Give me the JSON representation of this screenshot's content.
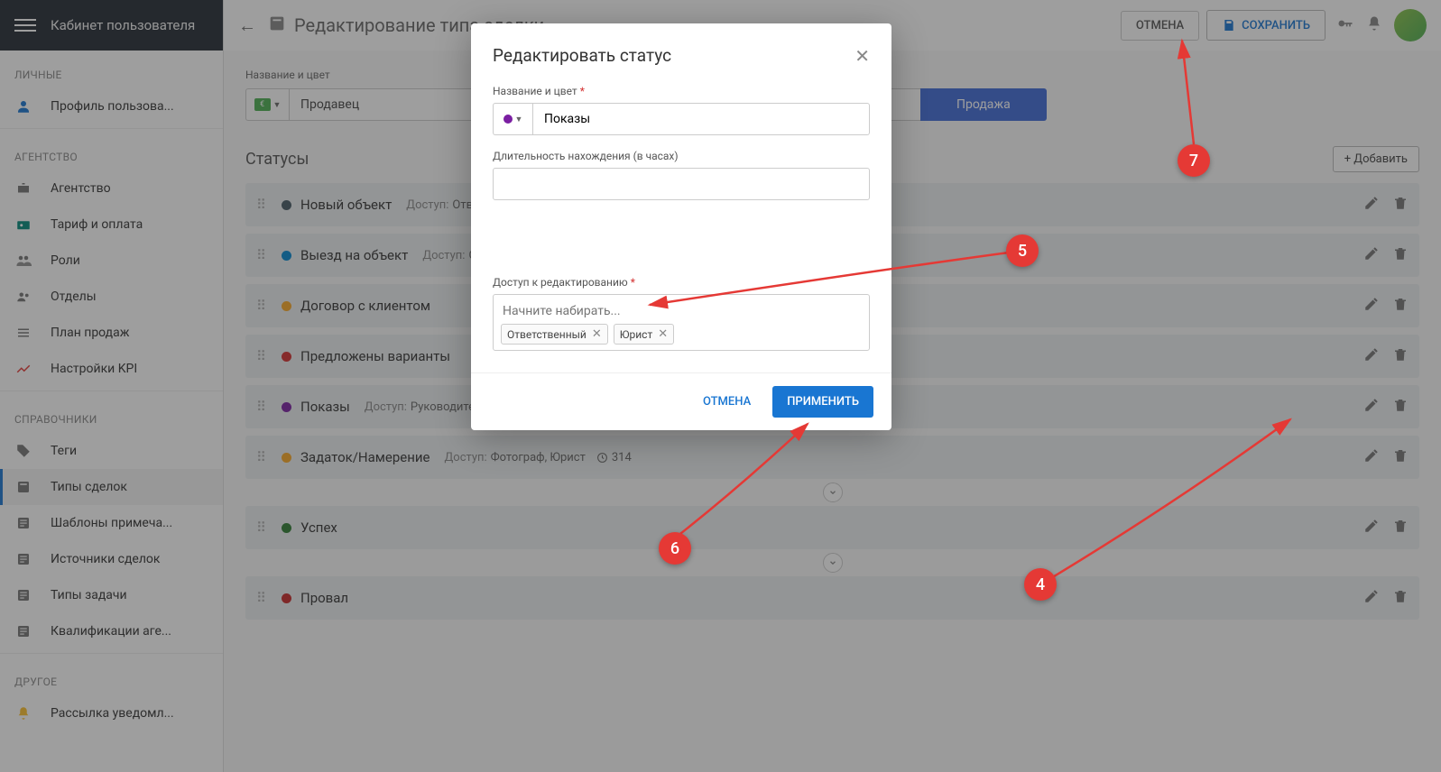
{
  "sidebar": {
    "title": "Кабинет пользователя",
    "sections": {
      "personal": "ЛИЧНЫЕ",
      "agency": "АГЕНТСТВО",
      "refs": "СПРАВОЧНИКИ",
      "other": "ДРУГОЕ"
    },
    "items": {
      "profile": "Профиль пользова...",
      "agency": "Агентство",
      "tariff": "Тариф и оплата",
      "roles": "Роли",
      "departments": "Отделы",
      "salesplan": "План продаж",
      "kpi": "Настройки KPI",
      "tags": "Теги",
      "dealtypes": "Типы сделок",
      "notetpl": "Шаблоны примеча...",
      "dealsrc": "Источники сделок",
      "tasktypes": "Типы задачи",
      "agentqual": "Квалификации аге...",
      "notify": "Рассылка уведомл..."
    }
  },
  "topbar": {
    "title": "Редактирование типа сделки",
    "cancel": "ОТМЕНА",
    "save": "СОХРАНИТЬ"
  },
  "form": {
    "name_label": "Название и цвет",
    "name_value": "Продавец",
    "deal_chip": "Продажа",
    "statuses_title": "Статусы",
    "add_btn": "+ Добавить",
    "access_label": "Доступ:",
    "rows": [
      {
        "name": "Новый объект",
        "color": "#455a64",
        "access": "Отв"
      },
      {
        "name": "Выезд на объект",
        "color": "#0288d1",
        "access": "С"
      },
      {
        "name": "Договор с клиентом",
        "color": "#f9a825",
        "access": ""
      },
      {
        "name": "Предложены варианты",
        "color": "#d32f2f",
        "access": ""
      },
      {
        "name": "Показы",
        "color": "#7b1fa2",
        "access": "Руководител"
      },
      {
        "name": "Задаток/Намерение",
        "color": "#f9a825",
        "access": "Фотограф, Юрист",
        "time": "314"
      },
      {
        "name": "Успех",
        "color": "#2e7d32",
        "access": ""
      },
      {
        "name": "Провал",
        "color": "#c62828",
        "access": ""
      }
    ]
  },
  "modal": {
    "title": "Редактировать статус",
    "name_label": "Название и цвет",
    "name_value": "Показы",
    "duration_label": "Длительность нахождения (в часах)",
    "access_label": "Доступ к редактированию",
    "access_placeholder": "Начните набирать...",
    "tags": [
      "Ответственный",
      "Юрист"
    ],
    "cancel": "ОТМЕНА",
    "apply": "ПРИМЕНИТЬ"
  },
  "annotations": {
    "4": "4",
    "5": "5",
    "6": "6",
    "7": "7"
  }
}
